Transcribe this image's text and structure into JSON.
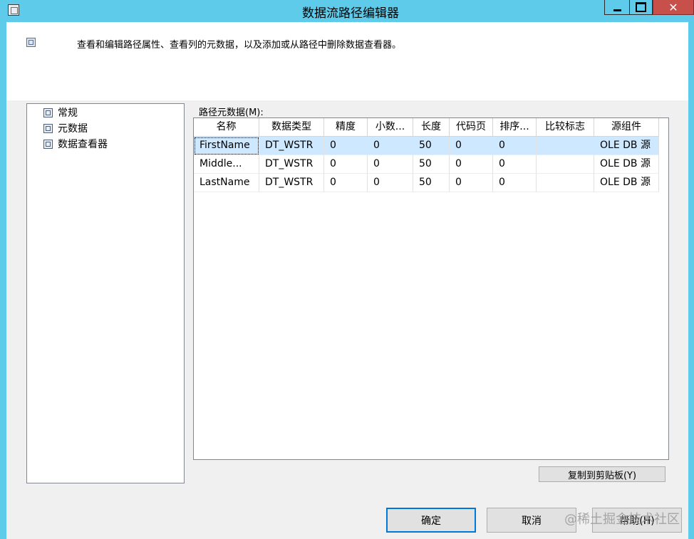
{
  "window": {
    "title": "数据流路径编辑器",
    "icons": {
      "system_menu": "window-system-icon",
      "minimize": "minimize-icon",
      "maximize": "maximize-icon",
      "close": "close-icon"
    },
    "close_glyph": "✕"
  },
  "header": {
    "description": "查看和编辑路径属性、查看列的元数据，以及添加或从路径中删除数据查看器。",
    "icon": "dialog-icon"
  },
  "nav": {
    "items": [
      {
        "label": "常规",
        "icon": "property-page-icon"
      },
      {
        "label": "元数据",
        "icon": "property-page-icon"
      },
      {
        "label": "数据查看器",
        "icon": "property-page-icon"
      }
    ]
  },
  "grid": {
    "caption": "路径元数据(M):",
    "columns": [
      "名称",
      "数据类型",
      "精度",
      "小数...",
      "长度",
      "代码页",
      "排序...",
      "比较标志",
      "源组件"
    ],
    "rows": [
      [
        "FirstName",
        "DT_WSTR",
        "0",
        "0",
        "50",
        "0",
        "0",
        "",
        "OLE DB 源"
      ],
      [
        "Middle...",
        "DT_WSTR",
        "0",
        "0",
        "50",
        "0",
        "0",
        "",
        "OLE DB 源"
      ],
      [
        "LastName",
        "DT_WSTR",
        "0",
        "0",
        "50",
        "0",
        "0",
        "",
        "OLE DB 源"
      ]
    ],
    "selected_row": 0
  },
  "buttons": {
    "copy": "复制到剪贴板(Y)",
    "ok": "确定",
    "cancel": "取消",
    "help": "帮助(H)"
  },
  "watermark": "@稀土掘金技术社区",
  "colors": {
    "titlebar": "#5ecbea",
    "close_button": "#c7504b",
    "selection": "#cde8ff",
    "default_button_border": "#0078d7"
  }
}
